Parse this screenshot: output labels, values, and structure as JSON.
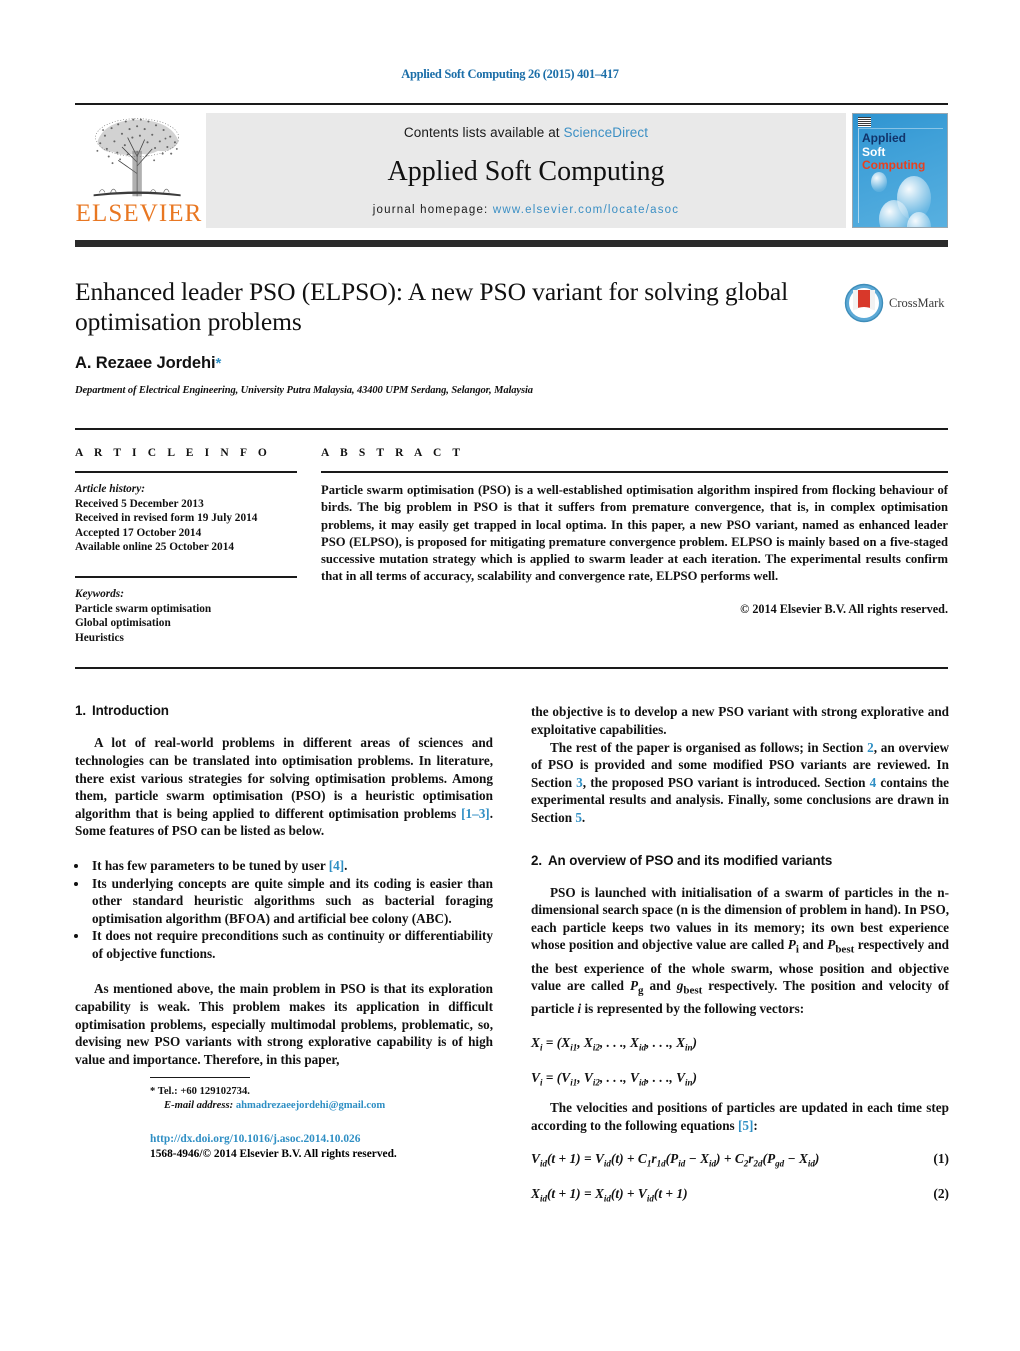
{
  "running_head": "Applied Soft Computing 26 (2015) 401–417",
  "masthead": {
    "publisher_name": "ELSEVIER",
    "contents_prefix": "Contents lists available at ",
    "contents_link": "ScienceDirect",
    "journal_name": "Applied Soft Computing",
    "homepage_label": "journal homepage:",
    "homepage_url": "www.elsevier.com/locate/asoc",
    "cover": {
      "line1": "Applied",
      "line2": "Soft",
      "line3": "Computing"
    },
    "colors": {
      "link_blue": "#3b8fc4",
      "elsevier_orange": "#e87722",
      "cover_blue": "#3fa0d8",
      "cover_red": "#e8401f",
      "cover_navy": "#11346b"
    }
  },
  "title_block": {
    "title": "Enhanced leader PSO (ELPSO): A new PSO variant for solving global optimisation problems",
    "author": "A. Rezaee Jordehi",
    "author_marker": "*",
    "affiliation": "Department of Electrical Engineering, University Putra Malaysia, 43400 UPM Serdang, Selangor, Malaysia",
    "crossmark_label": "CrossMark"
  },
  "article_info": {
    "heading": "A R T I C L E    I N F O",
    "history_label": "Article history:",
    "history": [
      "Received 5 December 2013",
      "Received in revised form 19 July 2014",
      "Accepted 17 October 2014",
      "Available online 25 October 2014"
    ],
    "keywords_label": "Keywords:",
    "keywords": [
      "Particle swarm optimisation",
      "Global optimisation",
      "Heuristics"
    ]
  },
  "abstract": {
    "heading": "A B S T R A C T",
    "text": "Particle swarm optimisation (PSO) is a well-established optimisation algorithm inspired from flocking behaviour of birds. The big problem in PSO is that it suffers from premature convergence, that is, in complex optimisation problems, it may easily get trapped in local optima. In this paper, a new PSO variant, named as enhanced leader PSO (ELPSO), is proposed for mitigating premature convergence problem. ELPSO is mainly based on a five-staged successive mutation strategy which is applied to swarm leader at each iteration. The experimental results confirm that in all terms of accuracy, scalability and convergence rate, ELPSO performs well.",
    "copyright": "© 2014 Elsevier B.V. All rights reserved."
  },
  "body": {
    "left": {
      "section1_num": "1.",
      "section1_title": "Introduction",
      "para1_a": "A lot of real-world problems in different areas of sciences and technologies can be translated into optimisation problems. In literature, there exist various strategies for solving optimisation problems. Among them, particle swarm optimisation (PSO) is a heuristic optimisation algorithm that is being applied to different optimisation problems ",
      "para1_ref": "[1–3]",
      "para1_b": ". Some features of PSO can be listed as below.",
      "bullet1_a": "It has few parameters to be tuned by user ",
      "bullet1_ref": "[4]",
      "bullet1_b": ".",
      "bullet2": "Its underlying concepts are quite simple and its coding is easier than other standard heuristic algorithms such as bacterial foraging optimisation algorithm (BFOA) and artificial bee colony (ABC).",
      "bullet3": "It does not require preconditions such as continuity or differentiability of objective functions.",
      "para2": "As mentioned above, the main problem in PSO is that its exploration capability is weak. This problem makes its application in difficult optimisation problems, especially multimodal problems, problematic, so, devising new PSO variants with strong explorative capability is of high value and importance. Therefore, in this paper,"
    },
    "right": {
      "para_cont": "the objective is to develop a new PSO variant with strong explorative and exploitative capabilities.",
      "para_org_a": "The rest of the paper is organised as follows; in Section ",
      "para_org_r1": "2",
      "para_org_b": ", an overview of PSO is provided and some modified PSO variants are reviewed. In Section ",
      "para_org_r2": "3",
      "para_org_c": ", the proposed PSO variant is introduced. Section ",
      "para_org_r3": "4",
      "para_org_d": " contains the experimental results and analysis. Finally, some conclusions are drawn in Section ",
      "para_org_r4": "5",
      "para_org_e": ".",
      "section2_num": "2.",
      "section2_title": "An overview of PSO and its modified variants",
      "para_pso": "PSO is launched with initialisation of a swarm of particles in the n-dimensional search space (n is the dimension of problem in hand). In PSO, each particle keeps two values in its memory; its own best experience whose position and objective value are called Pᵢ and Pʙᴇₛₜ respectively and the best experience of the whole swarm, whose position and objective value are called Pᵧ and gʙᴇₛₜ respectively. The position and velocity of particle i is represented by the following vectors:",
      "vector_x": "Xᵢ = (Xᵢ₁, Xᵢ₂, . . ., Xᵢₑ, . . ., Xᵢₙ)",
      "vector_v": "Vᵢ = (Vᵢ₁, Vᵢ₂, . . ., Vᵢₑ, . . ., Vᵢₙ)",
      "para_vel_a": "The velocities and positions of particles are updated in each time step according to the following equations ",
      "para_vel_ref": "[5]",
      "para_vel_b": ":",
      "eq1": "Vᵢₑ(t + 1) = Vᵢₑ(t) + C₁r₁ₑ(Pᵢₑ − Xᵢₑ) + C₂r₂ₑ(Pᵧₑ − Xᵢₑ)",
      "eq1_num": "(1)",
      "eq2": "Xᵢₑ(t + 1) = Xᵢₑ(t) + Vᵢₑ(t + 1)",
      "eq2_num": "(2)"
    }
  },
  "footer": {
    "tel_marker": "*",
    "tel": "Tel.: +60 129102734.",
    "email_label": "E-mail address:",
    "email": "ahmadrezaeejordehi@gmail.com",
    "doi": "http://dx.doi.org/10.1016/j.asoc.2014.10.026",
    "issn_line": "1568-4946/© 2014 Elsevier B.V. All rights reserved."
  }
}
